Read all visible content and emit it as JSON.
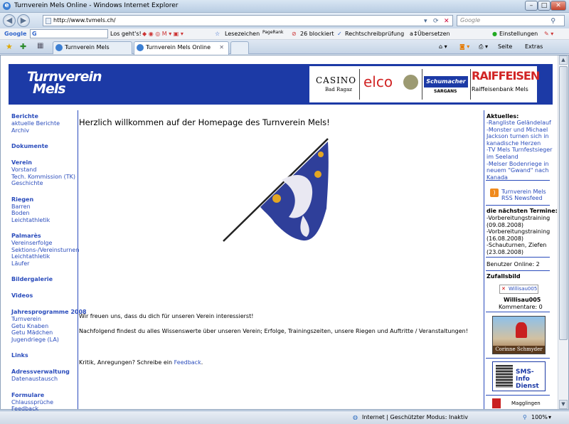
{
  "window": {
    "title": "Turnverein Mels Online - Windows Internet Explorer",
    "min": "–",
    "max": "□",
    "close": "✕"
  },
  "address": {
    "url": "http://www.tvmels.ch/",
    "search_placeholder": "Google"
  },
  "google_bar": {
    "logo": "Google",
    "search_prefix": "G",
    "go": "Los geht's!",
    "bookmarks": "Lesezeichen",
    "pagerank": "PageRank",
    "blocked": "26 blockiert",
    "spell": "Rechtschreibprüfung",
    "translate": "Übersetzen",
    "settings": "Einstellungen"
  },
  "tabs": [
    {
      "label": "Turnverein Mels"
    },
    {
      "label": "Turnverein Mels Online"
    }
  ],
  "tools": {
    "page": "Seite",
    "extras": "Extras"
  },
  "site": {
    "logo_line1": "Turnverein",
    "logo_line2": "Mels",
    "sponsors": {
      "casino": "CASINO",
      "casino_sub": "Bad Ragaz",
      "elco": "elco",
      "schumacher": "Schumacher",
      "schumacher_sub": "SARGANS",
      "raiffeisen": "RAIFFEISEN",
      "raiffeisen_sub": "Raiffeisenbank Mels"
    },
    "nav": [
      {
        "label": "Berichte",
        "h": true
      },
      {
        "label": "aktuelle Berichte"
      },
      {
        "label": "Archiv"
      },
      {
        "label": "Dokumente",
        "h": true
      },
      {
        "label": "Verein",
        "h": true
      },
      {
        "label": "Vorstand"
      },
      {
        "label": "Tech. Kommission (TK)"
      },
      {
        "label": "Geschichte"
      },
      {
        "label": "Riegen",
        "h": true
      },
      {
        "label": "Barren"
      },
      {
        "label": "Boden"
      },
      {
        "label": "Leichtathletik"
      },
      {
        "label": "Palmarès",
        "h": true
      },
      {
        "label": "Vereinserfolge"
      },
      {
        "label": "Sektions-/Vereinsturnen"
      },
      {
        "label": "Leichtathletik"
      },
      {
        "label": "Läufer"
      },
      {
        "label": "Bildergalerie",
        "h": true
      },
      {
        "label": "Videos",
        "h": true
      },
      {
        "label": "Jahresprogramme 2008",
        "h": true
      },
      {
        "label": "Turnverein"
      },
      {
        "label": "Getu Knaben"
      },
      {
        "label": "Getu Mädchen"
      },
      {
        "label": "Jugendriege (LA)"
      },
      {
        "label": "Links",
        "h": true
      },
      {
        "label": "Adressverwaltung",
        "h": true
      },
      {
        "label": "Datenaustausch"
      },
      {
        "label": "Formulare",
        "h": true
      },
      {
        "label": "Chlaussprüche"
      },
      {
        "label": "Feedback"
      }
    ],
    "heading": "Herzlich willkommen auf der Homepage des Turnverein Mels!",
    "p1": "Wir freuen uns, dass du dich für unseren Verein interessierst!",
    "p2": "Nachfolgend findest du alles Wissenswerte über unseren Verein; Erfolge, Trainingszeiten, unsere Riegen und Auftritte / Veranstaltungen!",
    "p3_prefix": "Kritik, Anregungen? Schreibe ein ",
    "p3_link": "Feedback",
    "p3_suffix": ".",
    "right": {
      "news_title": "Aktuelles:",
      "news": [
        "-Rangliste Geländelauf",
        "-Monster und Michael",
        " Jackson turnen sich in",
        " kanadische Herzen",
        "-TV Mels Turnfestsieger",
        " im Seeland",
        "-Melser Bodenriege in",
        " neuem \"Gwand\" nach",
        " Kanada"
      ],
      "rss1": "Turnverein Mels",
      "rss2": "RSS Newsfeed",
      "dates_title": "die nächsten Termine:",
      "dates": [
        "-Vorbereitungstraining",
        " (09.08.2008)",
        "-Vorbereitungstraining",
        " (16.08.2008)",
        "-Schauturnen, Ziefen",
        " (23.08.2008)"
      ],
      "online": "Benutzer Online: 2",
      "random_title": "Zufallsbild",
      "random_img": "Willisau005",
      "random_name": "Willisau005",
      "random_comments": "Kommentare: 0",
      "ad1": "Corinne Schmyder",
      "ad2a": "SMS-Info",
      "ad2b": "Dienst",
      "ad3": "Magglingen"
    }
  },
  "status": {
    "zone": "Internet | Geschützter Modus: Inaktiv",
    "zoom": "100%"
  }
}
